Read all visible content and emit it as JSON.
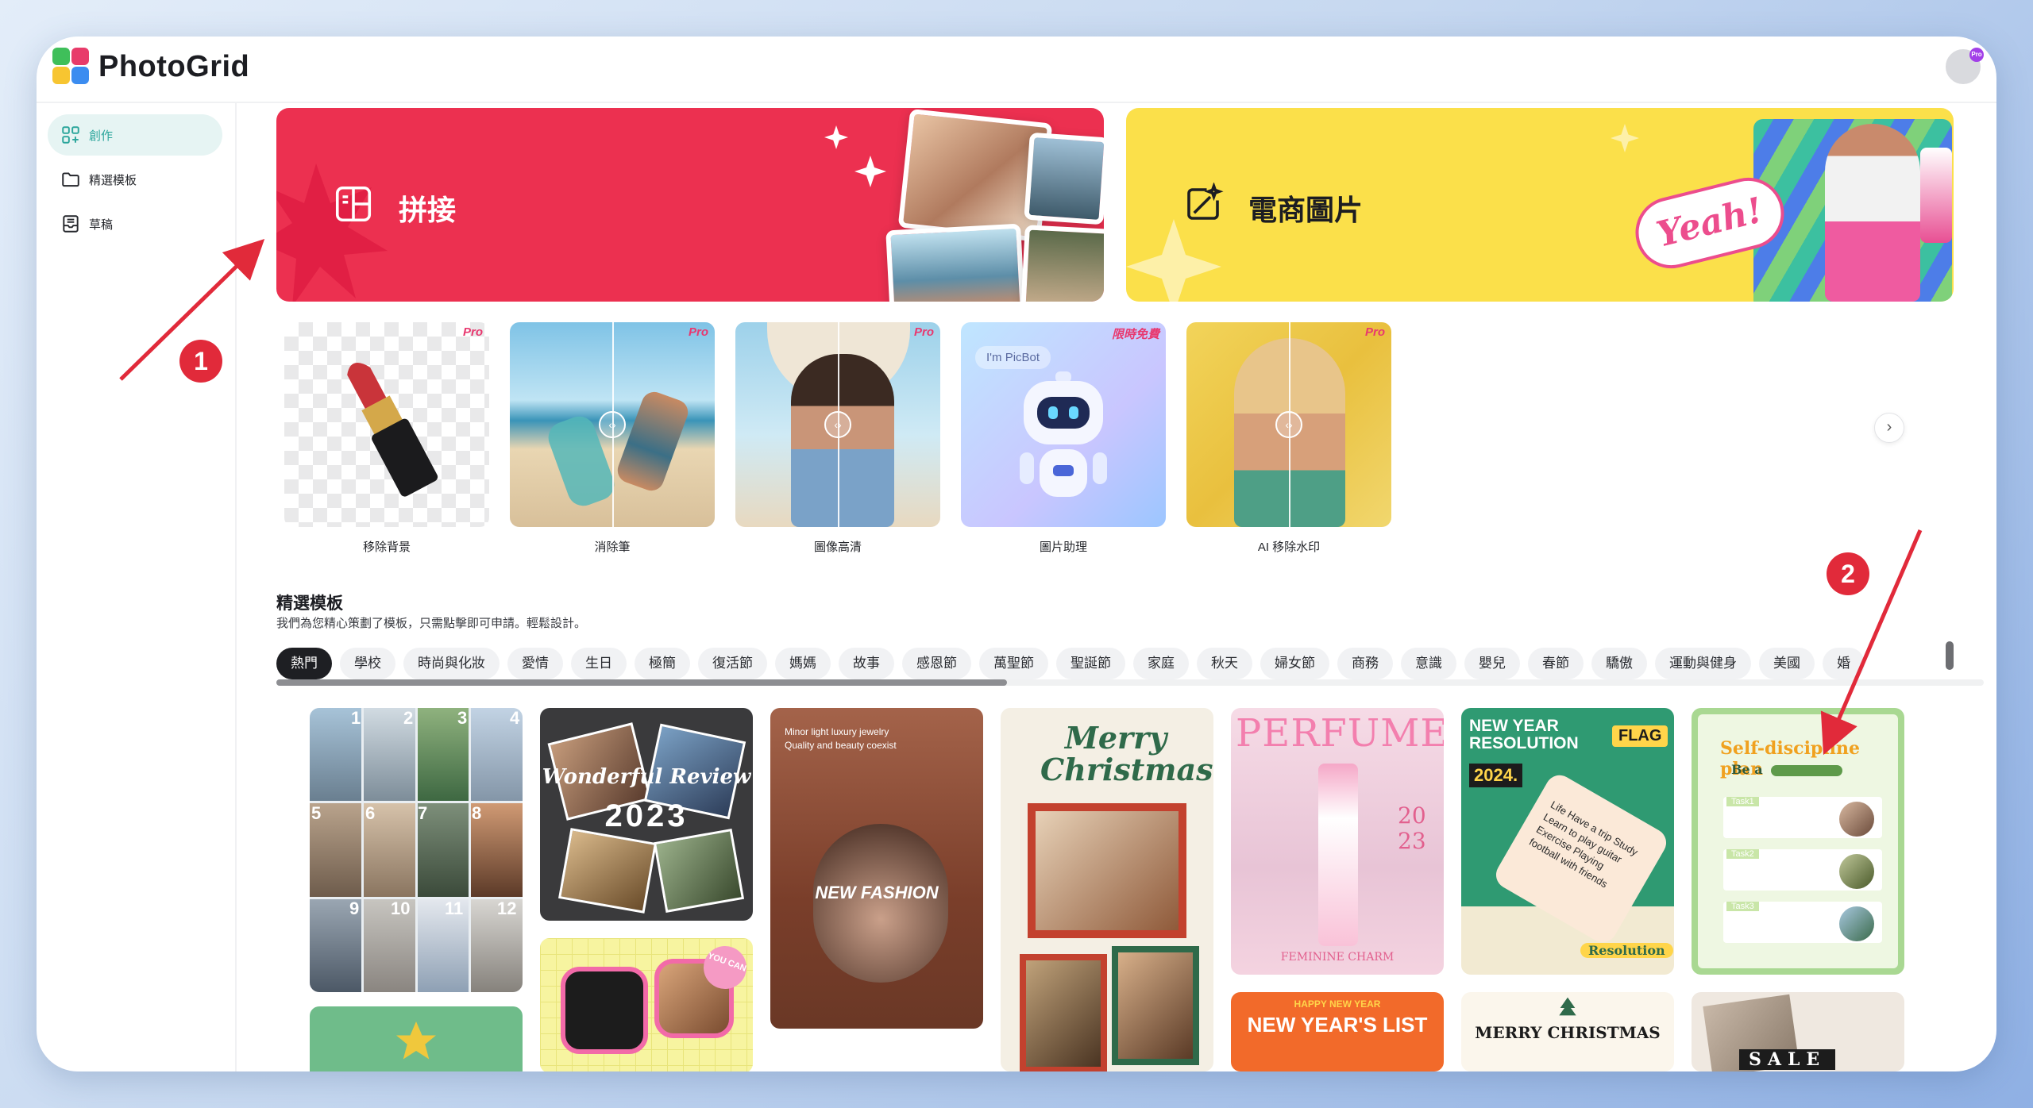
{
  "app": {
    "title": "PhotoGrid",
    "avatar_badge": "Pro"
  },
  "sidebar": {
    "items": [
      {
        "label": "創作",
        "icon": "grid-plus-icon",
        "active": true
      },
      {
        "label": "精選模板",
        "icon": "folder-icon",
        "active": false
      },
      {
        "label": "草稿",
        "icon": "inbox-icon",
        "active": false
      }
    ]
  },
  "banners": [
    {
      "label": "拼接",
      "icon": "collage-icon",
      "color": "#ec3050"
    },
    {
      "label": "電商圖片",
      "icon": "magic-image-icon",
      "color": "#fbe04a",
      "sticker": "Yeah!"
    }
  ],
  "tools": [
    {
      "label": "移除背景",
      "tag": "Pro"
    },
    {
      "label": "消除筆",
      "tag": "Pro"
    },
    {
      "label": "圖像高清",
      "tag": "Pro"
    },
    {
      "label": "圖片助理",
      "tag": "限時免費",
      "bubble": "I'm PicBot"
    },
    {
      "label": "AI 移除水印",
      "tag": "Pro"
    }
  ],
  "templates_section": {
    "title": "精選模板",
    "subtitle": "我們為您精心策劃了模板，只需點擊即可申請。輕鬆設計。",
    "categories": [
      "熱門",
      "學校",
      "時尚與化妝",
      "愛情",
      "生日",
      "極簡",
      "復活節",
      "媽媽",
      "故事",
      "感恩節",
      "萬聖節",
      "聖誕節",
      "家庭",
      "秋天",
      "婦女節",
      "商務",
      "意識",
      "嬰兒",
      "春節",
      "驕傲",
      "運動與健身",
      "美國",
      "婚"
    ],
    "active_category": "熱門"
  },
  "template_cards": {
    "calendar_months": [
      "1",
      "2",
      "3",
      "4",
      "5",
      "6",
      "7",
      "8",
      "9",
      "10",
      "11",
      "12"
    ],
    "review_title": "Wonderful Review",
    "review_year": "2023",
    "fashion_caption": "Minor light luxury jewelry Quality and beauty coexist",
    "fashion_title": "NEW FASHION",
    "christmas_title": "Merry Christmas",
    "perfume_title": "PERFUME",
    "perfume_year": "20 23",
    "perfume_footer": "FEMININE CHARM",
    "resolution_title": "NEW YEAR RESOLUTION",
    "resolution_flag": "FLAG",
    "resolution_year": "2024.",
    "resolution_tag": "Life Have a trip Study Learn to play guitar Exercise Playing football with friends",
    "resolution_footer": "Resolution",
    "plan_title": "Self-discipline plan",
    "plan_be": "Be a",
    "plan_tasks": [
      "Task1",
      "Task2",
      "Task3"
    ],
    "sticker_you_can": "YOU CAN",
    "newyear_list_small": "HAPPY NEW YEAR",
    "newyear_list_title": "NEW YEAR'S LIST",
    "merry_title": "MERRY CHRISTMAS",
    "sale_title": "SALE"
  },
  "annotations": [
    "1",
    "2"
  ],
  "colors": {
    "accent": "#2aa59b",
    "annotation": "#e12a3a",
    "pro_tag": "#e8386f"
  }
}
